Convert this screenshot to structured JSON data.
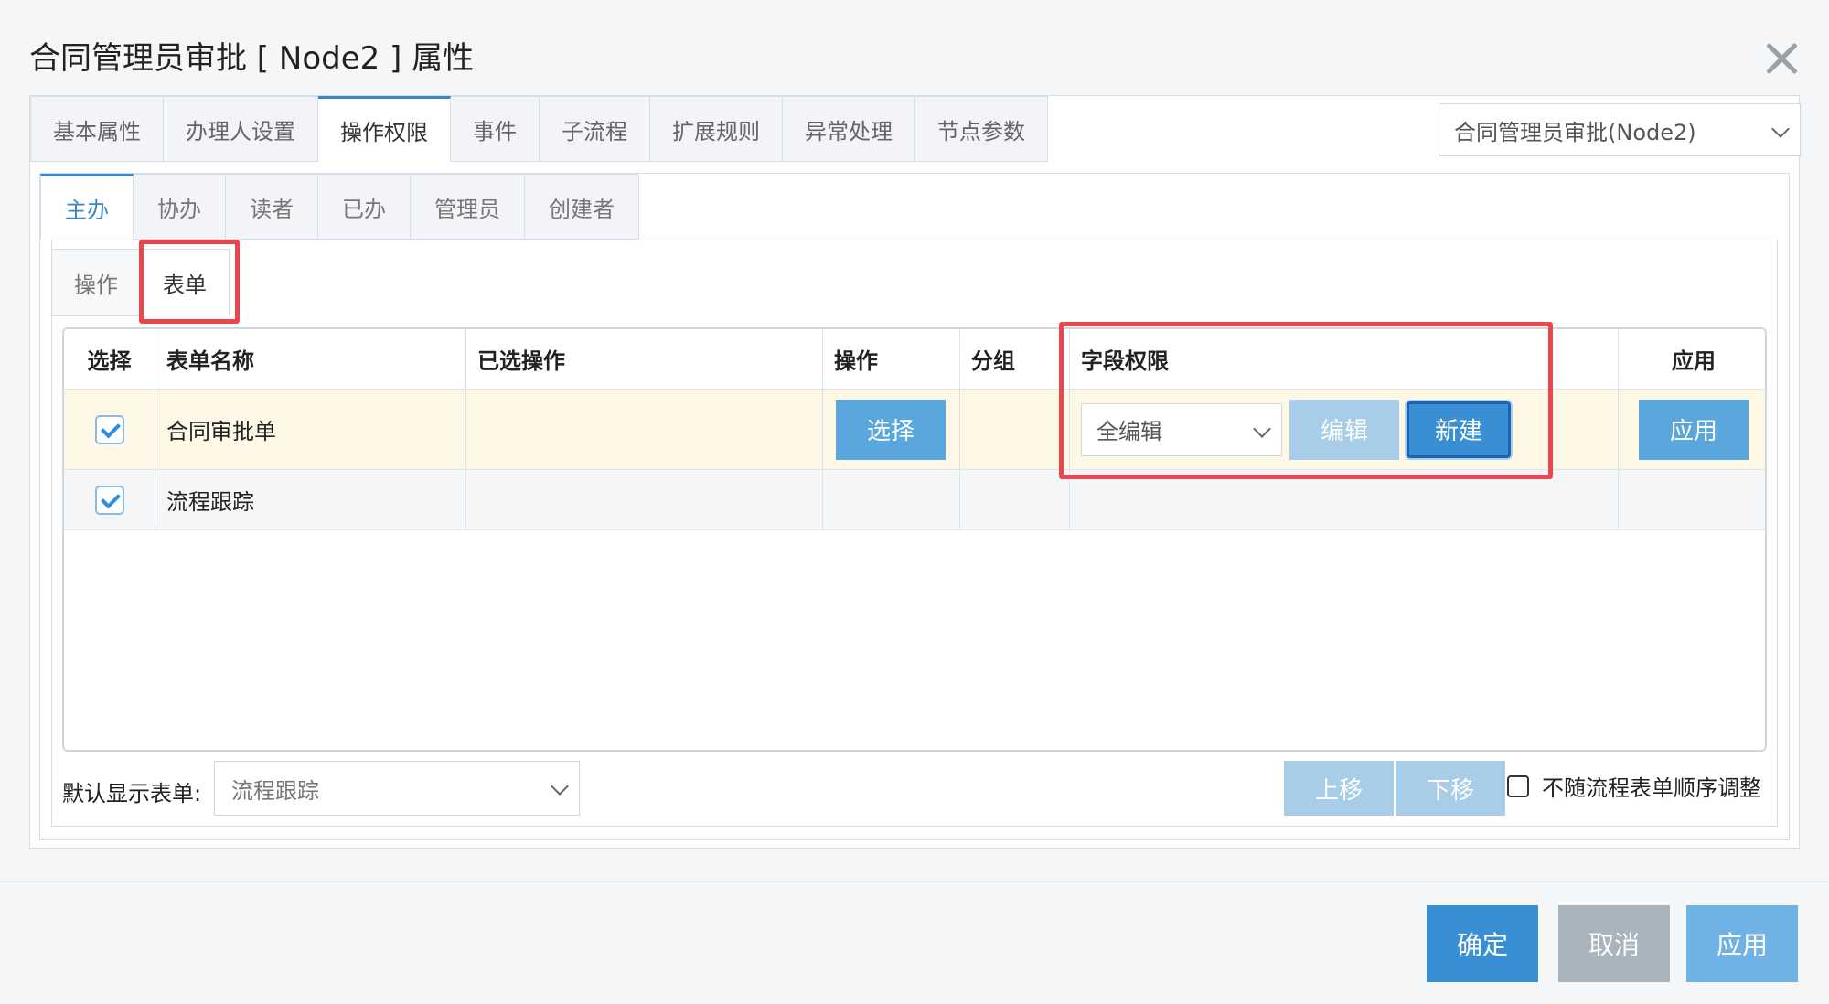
{
  "dialog": {
    "title": "合同管理员审批 [ Node2 ] 属性",
    "close_icon": "close-icon"
  },
  "main_tabs": [
    {
      "label": "基本属性",
      "active": false
    },
    {
      "label": "办理人设置",
      "active": false
    },
    {
      "label": "操作权限",
      "active": true
    },
    {
      "label": "事件",
      "active": false
    },
    {
      "label": "子流程",
      "active": false
    },
    {
      "label": "扩展规则",
      "active": false
    },
    {
      "label": "异常处理",
      "active": false
    },
    {
      "label": "节点参数",
      "active": false
    }
  ],
  "node_select": {
    "value": "合同管理员审批(Node2)"
  },
  "role_tabs": [
    {
      "label": "主办",
      "active": true
    },
    {
      "label": "协办",
      "active": false
    },
    {
      "label": "读者",
      "active": false
    },
    {
      "label": "已办",
      "active": false
    },
    {
      "label": "管理员",
      "active": false
    },
    {
      "label": "创建者",
      "active": false
    }
  ],
  "sub_tabs": [
    {
      "label": "操作",
      "active": false
    },
    {
      "label": "表单",
      "active": true
    }
  ],
  "table": {
    "headers": [
      "选择",
      "表单名称",
      "已选操作",
      "操作",
      "分组",
      "字段权限",
      "应用"
    ],
    "rows": [
      {
        "checked": true,
        "name": "合同审批单",
        "selected_ops": "",
        "op_button": "选择",
        "group": "",
        "field_perm": "全编辑",
        "edit_button": "编辑",
        "new_button": "新建",
        "apply_button": "应用"
      },
      {
        "checked": true,
        "name": "流程跟踪",
        "selected_ops": "",
        "group": ""
      }
    ]
  },
  "footer": {
    "default_form_label": "默认显示表单:",
    "default_form_value": "流程跟踪",
    "move_up": "上移",
    "move_down": "下移",
    "keep_order_label": "不随流程表单顺序调整",
    "keep_order_checked": false
  },
  "dialog_buttons": {
    "ok": "确定",
    "cancel": "取消",
    "apply": "应用"
  },
  "colors": {
    "accent": "#3b86c8",
    "button_blue": "#5aa7dd",
    "button_light": "#a7cde9",
    "highlight_red": "#e8474f",
    "row_highlight": "#fdf8e6"
  }
}
